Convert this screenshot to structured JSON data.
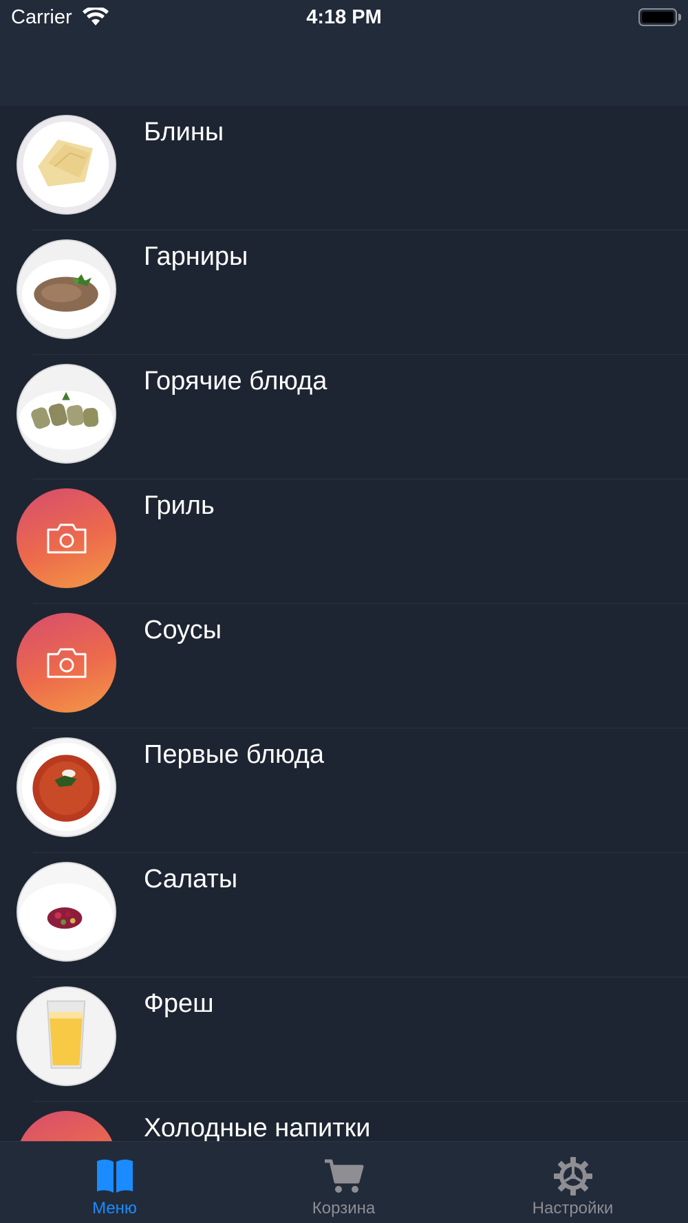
{
  "status_bar": {
    "carrier": "Carrier",
    "time": "4:18 PM"
  },
  "menu": {
    "items": [
      {
        "label": "Блины",
        "image": "pancakes-photo"
      },
      {
        "label": "Гарниры",
        "image": "buckwheat-photo"
      },
      {
        "label": "Горячие блюда",
        "image": "stuffed-rolls-photo"
      },
      {
        "label": "Гриль",
        "image": "camera-placeholder"
      },
      {
        "label": "Соусы",
        "image": "camera-placeholder"
      },
      {
        "label": "Первые блюда",
        "image": "borscht-photo"
      },
      {
        "label": "Салаты",
        "image": "vinaigrette-photo"
      },
      {
        "label": "Фреш",
        "image": "juice-photo"
      },
      {
        "label": "Холодные напитки",
        "image": "camera-placeholder"
      }
    ]
  },
  "tabbar": {
    "tabs": [
      {
        "label": "Меню",
        "icon": "book-icon",
        "active": true
      },
      {
        "label": "Корзина",
        "icon": "cart-icon",
        "active": false
      },
      {
        "label": "Настройки",
        "icon": "gear-icon",
        "active": false
      }
    ]
  },
  "colors": {
    "background": "#1e2532",
    "nav_background": "#222b3a",
    "accent": "#1a8cff",
    "inactive_tab": "#8e8e93",
    "placeholder_gradient": [
      "#d54d6e",
      "#f29a45"
    ]
  }
}
